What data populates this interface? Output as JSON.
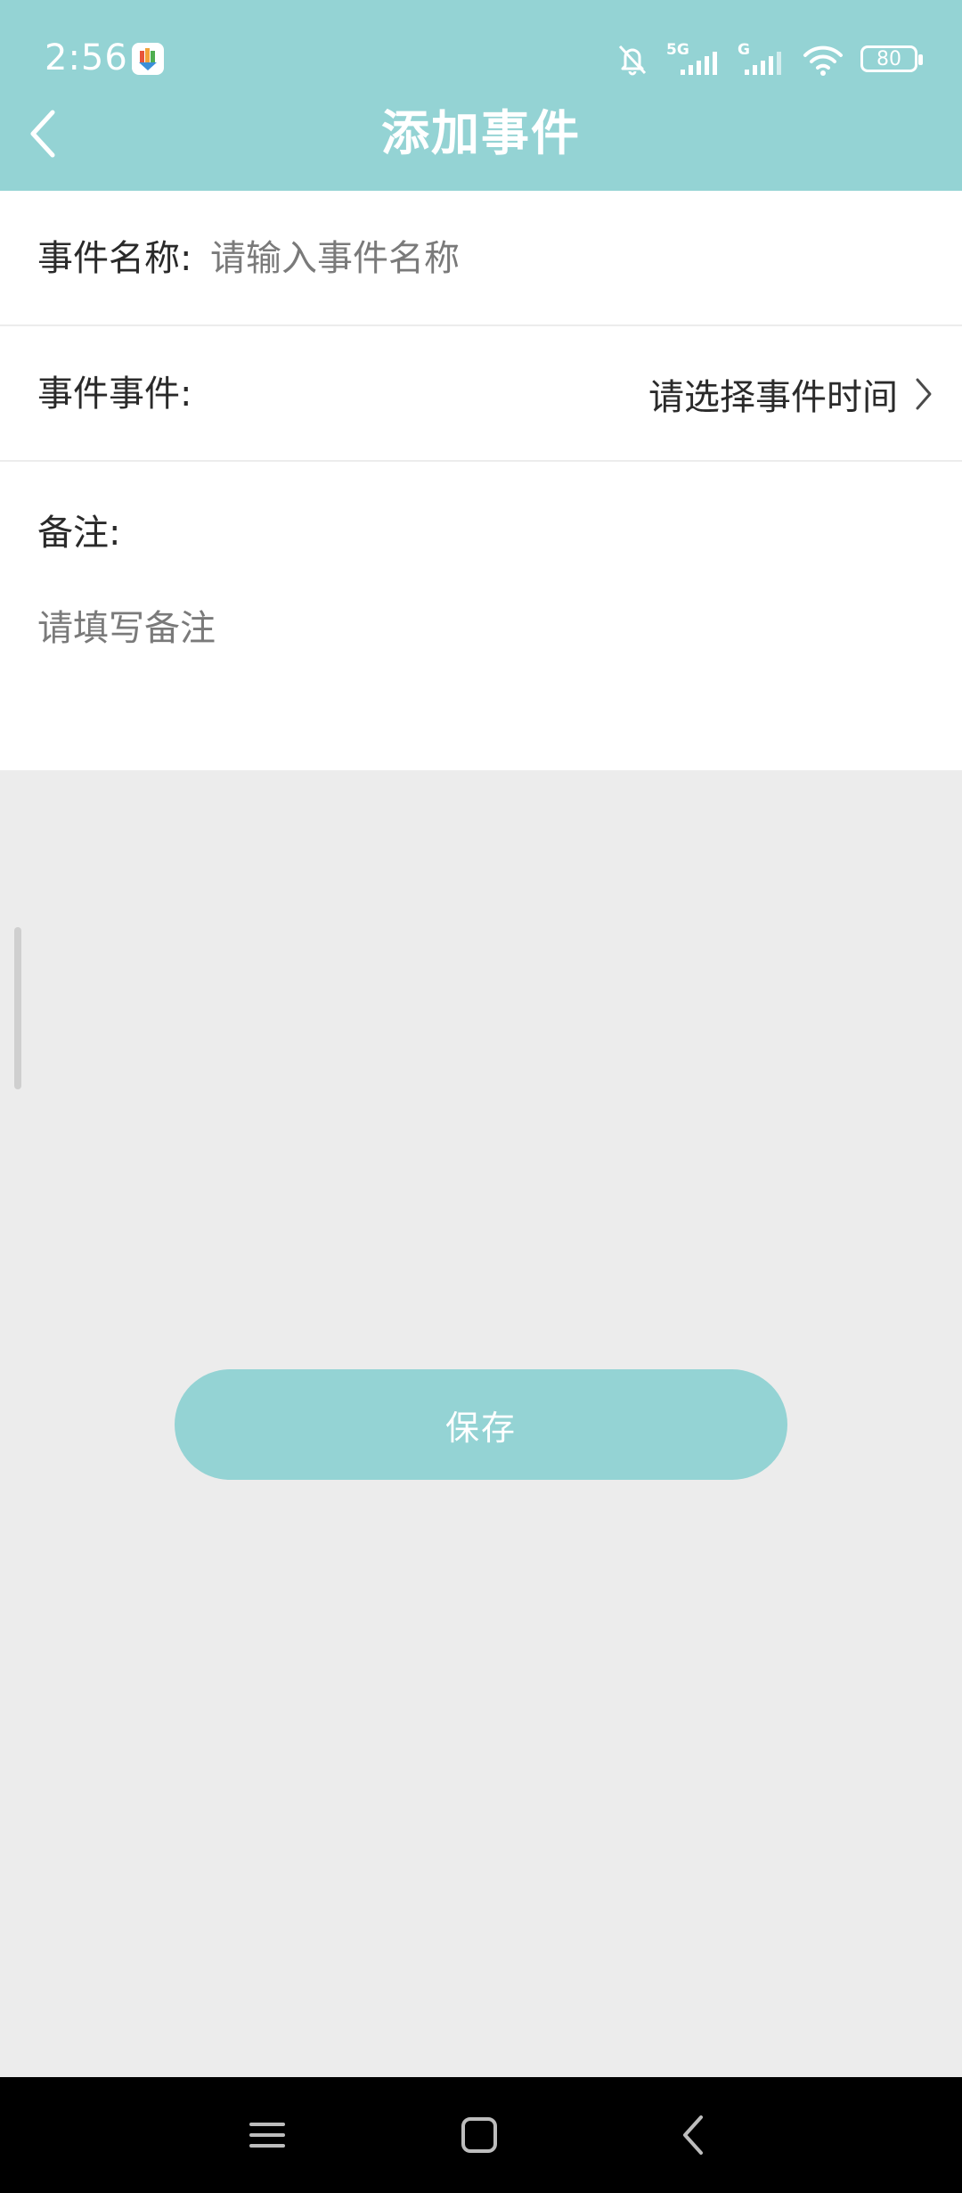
{
  "colors": {
    "accent": "#94d3d4",
    "content_background": "#ececec"
  },
  "status_bar": {
    "time": "2:56",
    "network_primary": "5G",
    "network_secondary": "G",
    "battery_level": "80",
    "icons": [
      "app-notification-icon",
      "bell-muted-icon",
      "signal-5g-icon",
      "signal-g-icon",
      "wifi-icon",
      "battery-icon"
    ]
  },
  "header": {
    "title": "添加事件",
    "back_icon": "chevron-left-icon"
  },
  "form": {
    "name": {
      "label": "事件名称:",
      "placeholder": "请输入事件名称",
      "value": ""
    },
    "time": {
      "label": "事件事件:",
      "value": "请选择事件时间",
      "icon": "chevron-right-icon"
    },
    "note": {
      "label": "备注:",
      "placeholder": "请填写备注",
      "value": ""
    }
  },
  "actions": {
    "save_label": "保存"
  },
  "nav_bar": {
    "icons": [
      "menu-icon",
      "home-icon",
      "back-icon"
    ]
  }
}
